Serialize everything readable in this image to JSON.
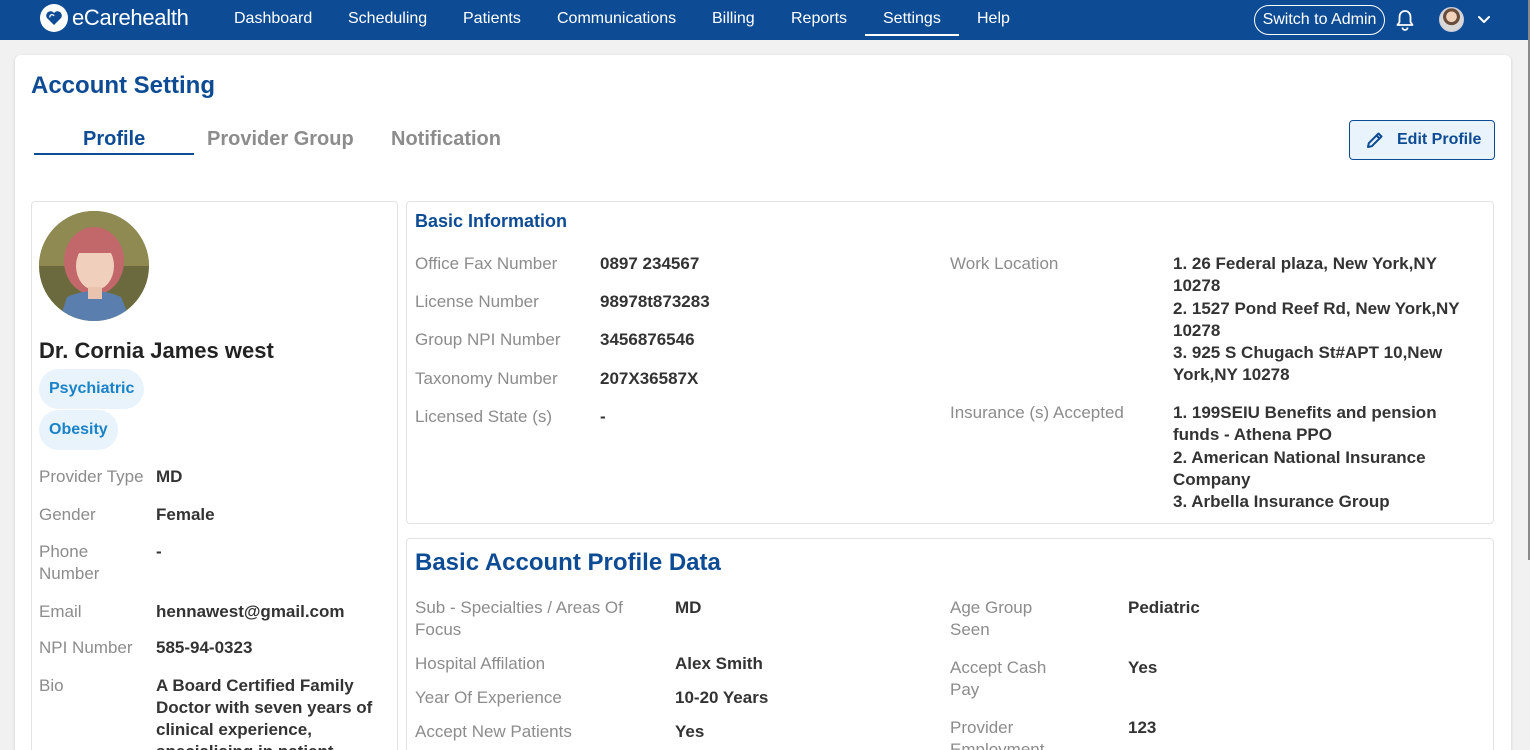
{
  "app": {
    "brand_light": "eCare",
    "brand_bold": "health"
  },
  "nav": {
    "items": [
      "Dashboard",
      "Scheduling",
      "Patients",
      "Communications",
      "Billing",
      "Reports",
      "Settings",
      "Help"
    ],
    "active": "Settings",
    "switch_label": "Switch to Admin",
    "bell_icon": "bell-icon",
    "menu_icon": "chevron-down-icon"
  },
  "page": {
    "title": "Account Setting",
    "tabs": [
      "Profile",
      "Provider Group",
      "Notification"
    ],
    "active_tab": "Profile",
    "edit_label": "Edit Profile"
  },
  "profile": {
    "name": "Dr. Cornia James west",
    "chips": [
      "Psychiatric",
      "Obesity"
    ],
    "fields": [
      {
        "label": "Provider Type",
        "value": "MD"
      },
      {
        "label": "Gender",
        "value": "Female"
      },
      {
        "label": "Phone Number",
        "value": "-"
      },
      {
        "label": "Email",
        "value": "hennawest@gmail.com"
      },
      {
        "label": "NPI Number",
        "value": "585-94-0323"
      },
      {
        "label": "Bio",
        "value": "A Board Certified Family Doctor with seven years of clinical experience, specialising in patient"
      }
    ]
  },
  "basic_info": {
    "title": "Basic Information",
    "left_fields": [
      {
        "label": "Office Fax Number",
        "value": "0897 234567"
      },
      {
        "label": "License Number",
        "value": "98978t873283"
      },
      {
        "label": "Group NPI Number",
        "value": "3456876546"
      },
      {
        "label": "Taxonomy Number",
        "value": "207X36587X"
      },
      {
        "label": "Licensed State (s)",
        "value": "-"
      }
    ],
    "work_location": {
      "label": "Work Location",
      "lines": [
        "1. 26 Federal plaza, New York,NY",
        "10278",
        "2. 1527 Pond Reef Rd, New York,NY",
        "10278",
        "3. 925 S Chugach St#APT 10,New",
        "York,NY 10278"
      ]
    },
    "insurance": {
      "label": "Insurance (s) Accepted",
      "lines": [
        "1. 199SEIU Benefits and pension",
        "funds - Athena PPO",
        "2. American National Insurance",
        "Company",
        "3. Arbella Insurance Group"
      ]
    }
  },
  "account_profile": {
    "title": "Basic Account Profile Data",
    "left_fields": [
      {
        "label": "Sub - Specialties / Areas Of Focus",
        "value": "MD"
      },
      {
        "label": "Hospital Affilation",
        "value": "Alex Smith"
      },
      {
        "label": "Year Of Experience",
        "value": "10-20 Years"
      },
      {
        "label": "Accept New Patients",
        "value": "Yes"
      }
    ],
    "right_fields": [
      {
        "label": "Age Group Seen",
        "value": "Pediatric"
      },
      {
        "label": "Accept Cash Pay",
        "value": "Yes"
      },
      {
        "label": "Provider Employment",
        "value": "123"
      }
    ]
  },
  "colors": {
    "brand_blue": "#0d4b94",
    "chip_bg": "#e8f3fb",
    "chip_text": "#1a82c8",
    "label_gray": "#8c8c8c"
  }
}
